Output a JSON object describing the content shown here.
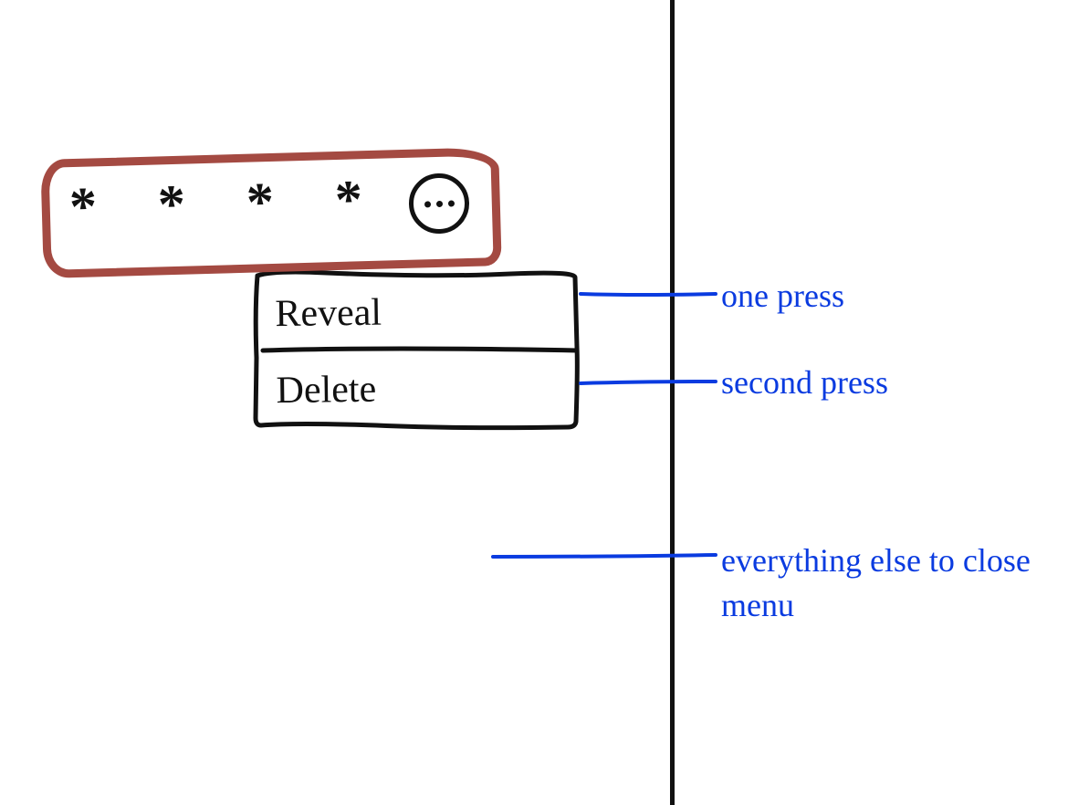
{
  "password_field": {
    "masked_value": "* * * *",
    "more_button_name": "more-options"
  },
  "menu": {
    "items": [
      {
        "label": "Reveal",
        "name": "menu-item-reveal"
      },
      {
        "label": "Delete",
        "name": "menu-item-delete"
      }
    ]
  },
  "annotations": {
    "first": "one press",
    "second": "second press",
    "rest": "everything else to close menu"
  },
  "colors": {
    "outline_red": "#a44a42",
    "annotation_blue": "#0a3be0",
    "ink": "#111111"
  }
}
